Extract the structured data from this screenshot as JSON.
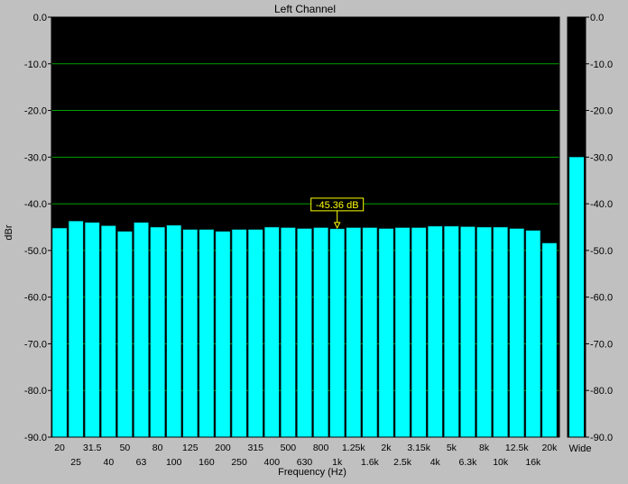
{
  "window": {
    "title": "Left Channel",
    "background": "#c0c0c0"
  },
  "chart_data": {
    "type": "bar",
    "title": "Left Channel",
    "xlabel": "Frequency (Hz)",
    "ylabel": "dBr",
    "ylim": [
      -90,
      0
    ],
    "y_ticks": [
      "0.0",
      "-10.0",
      "-20.0",
      "-30.0",
      "-40.0",
      "-50.0",
      "-60.0",
      "-70.0",
      "-80.0",
      "-90.0"
    ],
    "grid": true,
    "categories": [
      "20",
      "25",
      "31.5",
      "40",
      "50",
      "63",
      "80",
      "100",
      "125",
      "160",
      "200",
      "250",
      "315",
      "400",
      "500",
      "630",
      "800",
      "1k",
      "1.25k",
      "1.6k",
      "2k",
      "2.5k",
      "3.15k",
      "4k",
      "5k",
      "6.3k",
      "8k",
      "10k",
      "12.5k",
      "16k",
      "20k"
    ],
    "values": [
      -45.2,
      -43.7,
      -44.0,
      -44.7,
      -45.9,
      -44.0,
      -45.0,
      -44.6,
      -45.5,
      -45.5,
      -45.9,
      -45.5,
      -45.5,
      -45.0,
      -45.1,
      -45.3,
      -45.1,
      -45.36,
      -45.1,
      -45.1,
      -45.3,
      -45.1,
      -45.1,
      -44.8,
      -44.8,
      -44.9,
      -45.0,
      -45.0,
      -45.3,
      -45.7,
      -48.4
    ],
    "annotation": {
      "text": "-45.36 dB",
      "category": "1k"
    },
    "side_meter": {
      "label": "Wide",
      "value": -30.0
    },
    "colors": {
      "bar": "#00ffff",
      "bar_edge": "#004444",
      "plot_background": "#000000",
      "grid": "#00a000",
      "annotation_text": "#ffff00"
    }
  }
}
